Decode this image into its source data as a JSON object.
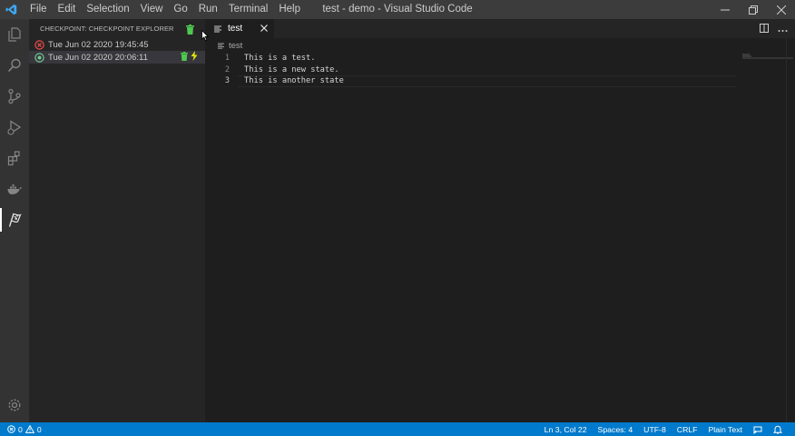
{
  "titlebar": {
    "window_title": "test - demo - Visual Studio Code",
    "menu": [
      "File",
      "Edit",
      "Selection",
      "View",
      "Go",
      "Run",
      "Terminal",
      "Help"
    ],
    "logo_icon": "vscode-logo",
    "controls": [
      "minimize-icon",
      "restore-icon",
      "close-icon"
    ]
  },
  "activitybar": {
    "items": [
      "explorer-icon",
      "search-icon",
      "source-control-icon",
      "run-debug-icon",
      "extensions-icon",
      "docker-icon",
      "checkpoint-flag-icon"
    ],
    "active": "checkpoint-flag-icon",
    "bottom": "gear-icon"
  },
  "sidebar": {
    "title": "Checkpoint: Checkpoint Explorer",
    "header_action_icon": "trash-icon",
    "checkpoints": [
      {
        "label": "Tue Jun 02 2020 19:45:45",
        "status": "deleted",
        "status_color": "#f14c4c"
      },
      {
        "label": "Tue Jun 02 2020 20:06:11",
        "status": "current",
        "status_color": "#73c991",
        "selected": true,
        "actions": [
          "trash-icon",
          "restore-lightning-icon"
        ]
      }
    ]
  },
  "editor": {
    "tab": {
      "label": "test",
      "icon": "file-lines-icon",
      "close_icon": "close-icon"
    },
    "actions": [
      "split-editor-icon",
      "more-actions-icon"
    ],
    "breadcrumb": "test",
    "lines": [
      {
        "number": "1",
        "text": "This is a test."
      },
      {
        "number": "2",
        "text": "This is a new state."
      },
      {
        "number": "3",
        "text": "This is another state"
      }
    ],
    "current_line": 3
  },
  "statusbar": {
    "errors": "0",
    "warnings": "0",
    "position": "Ln 3, Col 22",
    "spaces": "Spaces: 4",
    "encoding": "UTF-8",
    "eol": "CRLF",
    "language": "Plain Text",
    "feedback_icon": "feedback-icon",
    "bell_icon": "bell-icon"
  },
  "colors": {
    "statusbar_bg": "#007acc",
    "trash_green": "#4ec94e",
    "lightning_yellow": "#e5e510"
  }
}
